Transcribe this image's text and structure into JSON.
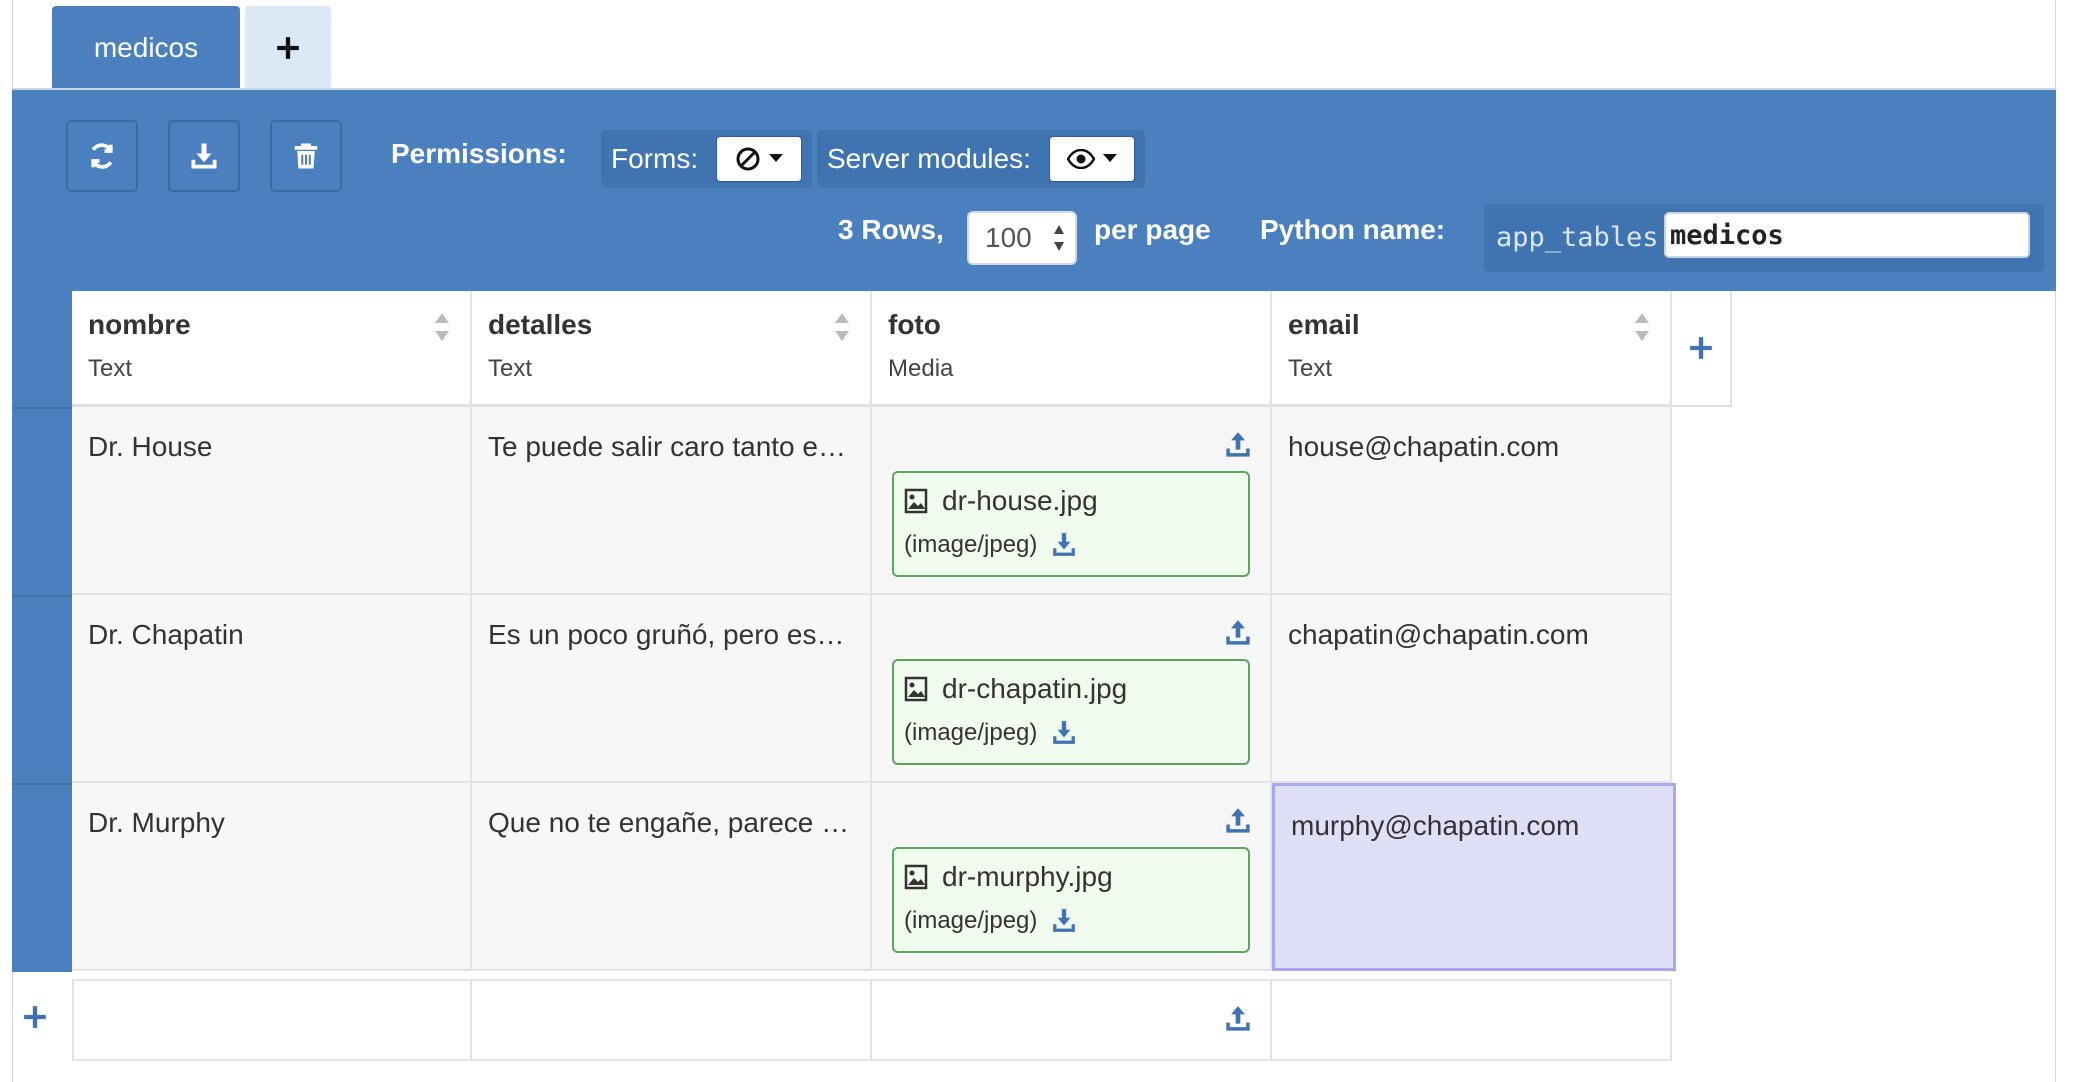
{
  "tabs": [
    {
      "label": "medicos",
      "active": true
    }
  ],
  "tab_add_icon": "plus-icon",
  "toolbar": {
    "refresh_icon": "refresh-icon",
    "download_icon": "download-icon",
    "delete_icon": "trash-icon",
    "permissions_label": "Permissions:",
    "forms_label": "Forms:",
    "forms_value_icon": "no-access-icon",
    "server_modules_label": "Server modules:",
    "server_modules_value_icon": "eye-icon",
    "rows_count_label": "3 Rows,",
    "rows_per_page_value": "100",
    "per_page_label": "per page",
    "python_name_label": "Python name:",
    "python_prefix": "app_tables.",
    "python_name_value": "medicos"
  },
  "table": {
    "columns": [
      {
        "name": "nombre",
        "type": "Text"
      },
      {
        "name": "detalles",
        "type": "Text"
      },
      {
        "name": "foto",
        "type": "Media"
      },
      {
        "name": "email",
        "type": "Text"
      }
    ],
    "rows": [
      {
        "nombre": "Dr. House",
        "detalles": "Te puede salir caro tanto e…",
        "foto": {
          "filename": "dr-house.jpg",
          "mime": "(image/jpeg)"
        },
        "email": "house@chapatin.com"
      },
      {
        "nombre": "Dr. Chapatin",
        "detalles": "Es un poco gruñó, pero es…",
        "foto": {
          "filename": "dr-chapatin.jpg",
          "mime": "(image/jpeg)"
        },
        "email": "chapatin@chapatin.com"
      },
      {
        "nombre": "Dr. Murphy",
        "detalles": "Que no te engañe, parece …",
        "foto": {
          "filename": "dr-murphy.jpg",
          "mime": "(image/jpeg)"
        },
        "email": "murphy@chapatin.com"
      }
    ],
    "selected_cell": {
      "row": 3,
      "column": "email"
    }
  },
  "colors": {
    "toolbar_blue": "#4a80bd",
    "media_green_border": "#5ba55e",
    "media_green_bg": "#f0fbee",
    "selected_cell_bg": "#dfe0f7"
  }
}
